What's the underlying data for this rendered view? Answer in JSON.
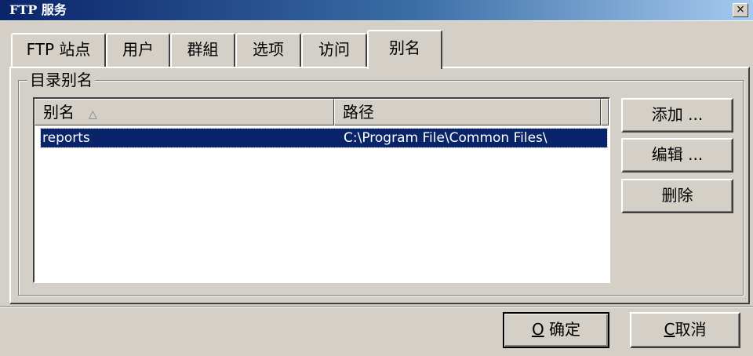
{
  "window": {
    "title": "FTP 服务",
    "close_glyph": "×"
  },
  "tabs": [
    {
      "label": "FTP 站点",
      "active": false
    },
    {
      "label": "用户",
      "active": false
    },
    {
      "label": "群組",
      "active": false
    },
    {
      "label": "选项",
      "active": false
    },
    {
      "label": "访问",
      "active": false
    },
    {
      "label": "别名",
      "active": true
    }
  ],
  "alias_group": {
    "label": "目录别名"
  },
  "list": {
    "columns": [
      {
        "label": "别名",
        "sort_icon": "△"
      },
      {
        "label": "路径"
      }
    ],
    "rows": [
      {
        "alias": "reports",
        "path": "C:\\Program File\\Common Files\\",
        "selected": true
      }
    ]
  },
  "side_buttons": {
    "add": "添加 ...",
    "edit": "编辑 ...",
    "delete": "删除"
  },
  "footer": {
    "ok_mnemonic": "O",
    "ok_text": "确定",
    "cancel_mnemonic": "C",
    "cancel_text": "取消"
  },
  "colors": {
    "title_start": "#0a246a",
    "selection": "#0a246a",
    "face": "#d4d0c8"
  }
}
